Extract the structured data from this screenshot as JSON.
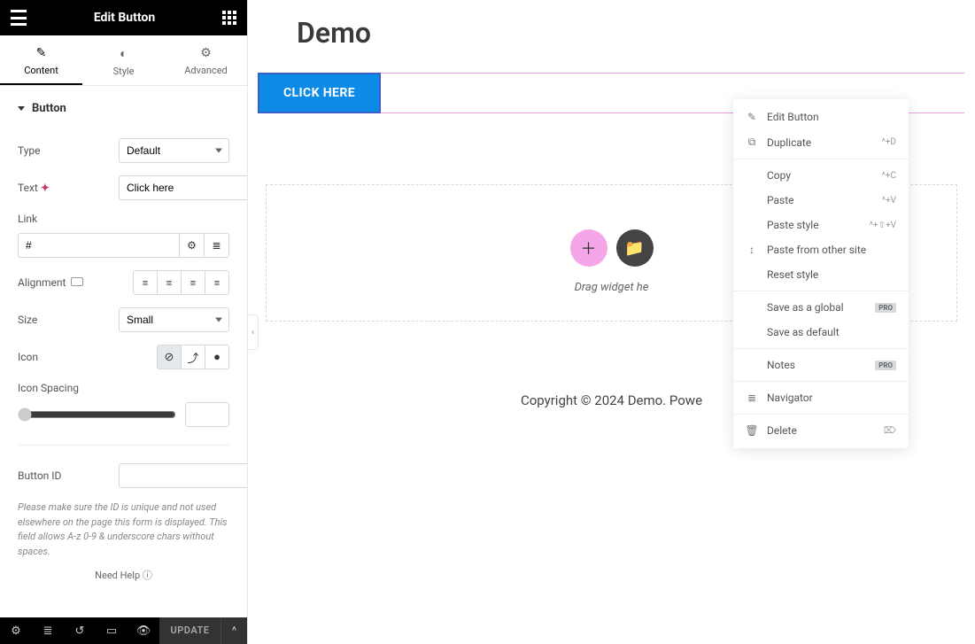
{
  "sidebar": {
    "title": "Edit Button",
    "tabs": {
      "content": "Content",
      "style": "Style",
      "advanced": "Advanced"
    },
    "section_label": "Button",
    "controls": {
      "type": {
        "label": "Type",
        "value": "Default"
      },
      "text": {
        "label": "Text",
        "value": "Click here"
      },
      "link": {
        "label": "Link",
        "value": "#"
      },
      "alignment": {
        "label": "Alignment"
      },
      "size": {
        "label": "Size",
        "value": "Small"
      },
      "icon": {
        "label": "Icon"
      },
      "icon_spacing": {
        "label": "Icon Spacing"
      },
      "button_id": {
        "label": "Button ID",
        "value": ""
      },
      "help_text": "Please make sure the ID is unique and not used elsewhere on the page this form is displayed. This field allows A-z 0-9 & underscore chars without spaces."
    },
    "need_help": "Need Help ⓘ",
    "footer": {
      "update": "UPDATE"
    }
  },
  "canvas": {
    "page_title": "Demo",
    "button_text": "CLICK HERE",
    "drop_text": "Drag widget he",
    "footer_text": "Copyright © 2024 Demo. Powe"
  },
  "context_menu": {
    "items": [
      {
        "icon": "✎",
        "label": "Edit Button",
        "shortcut": ""
      },
      {
        "icon": "⧉",
        "label": "Duplicate",
        "shortcut": "^+D"
      },
      {
        "sep": true
      },
      {
        "icon": "",
        "label": "Copy",
        "shortcut": "^+C"
      },
      {
        "icon": "",
        "label": "Paste",
        "shortcut": "^+V"
      },
      {
        "icon": "",
        "label": "Paste style",
        "shortcut": "^+⇧+V"
      },
      {
        "icon": "↕",
        "label": "Paste from other site",
        "shortcut": ""
      },
      {
        "icon": "",
        "label": "Reset style",
        "shortcut": ""
      },
      {
        "sep": true
      },
      {
        "icon": "",
        "label": "Save as a global",
        "shortcut": "",
        "pro": true
      },
      {
        "icon": "",
        "label": "Save as default",
        "shortcut": ""
      },
      {
        "sep": true
      },
      {
        "icon": "",
        "label": "Notes",
        "shortcut": "",
        "pro": true
      },
      {
        "sep": true
      },
      {
        "icon": "≣",
        "label": "Navigator",
        "shortcut": ""
      },
      {
        "sep": true
      },
      {
        "icon": "🗑",
        "label": "Delete",
        "shortcut": "⌦"
      }
    ]
  }
}
